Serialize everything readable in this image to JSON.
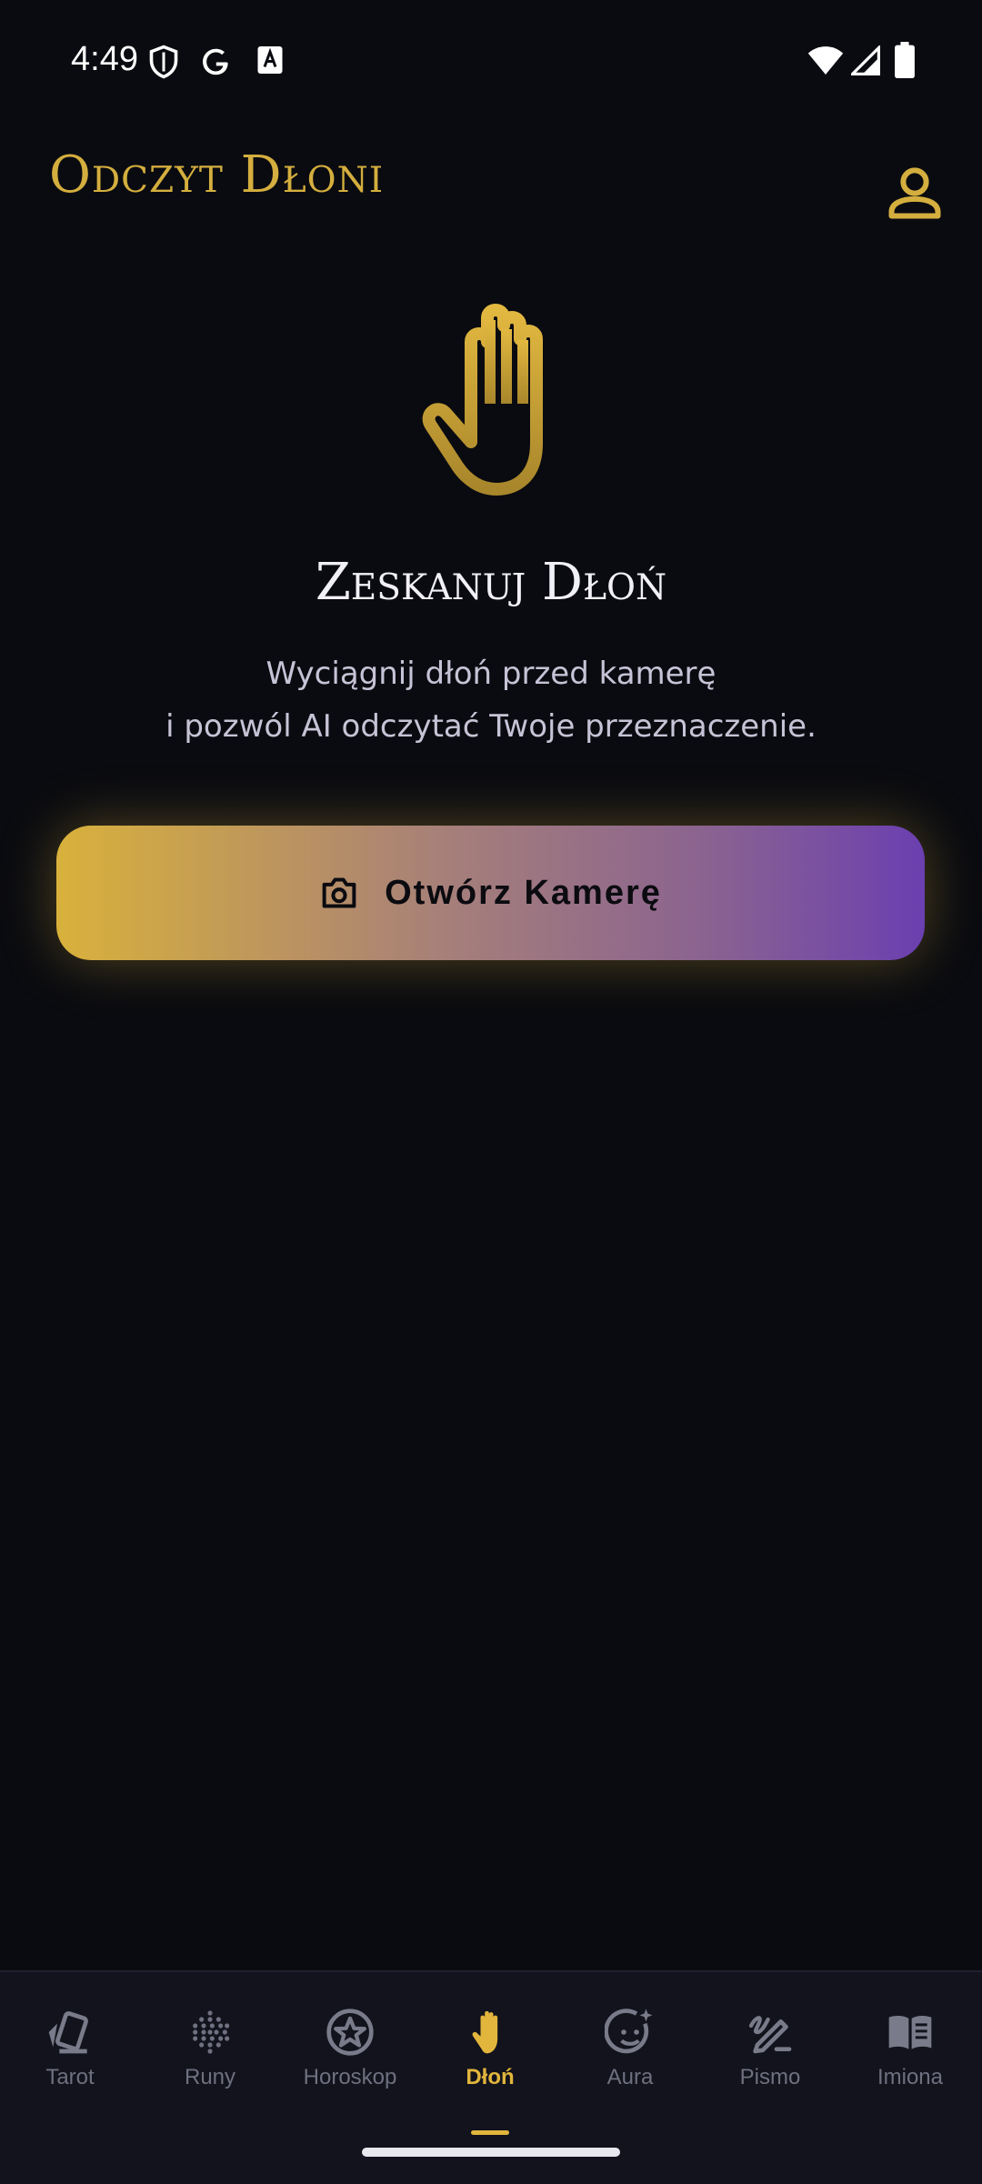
{
  "status_bar": {
    "time": "4:49"
  },
  "header": {
    "title": "Odczyt Dłoni"
  },
  "main": {
    "title": "Zeskanuj Dłoń",
    "description_line1": "Wyciągnij dłoń przed kamerę",
    "description_line2": "i pozwól AI odczytać Twoje przeznaczenie.",
    "camera_button_label": "Otwórz Kamerę"
  },
  "bottom_nav": {
    "items": [
      {
        "label": "Tarot",
        "icon": "tarot-cards-icon",
        "active": false
      },
      {
        "label": "Runy",
        "icon": "runes-dots-icon",
        "active": false
      },
      {
        "label": "Horoskop",
        "icon": "star-circle-icon",
        "active": false
      },
      {
        "label": "Dłoń",
        "icon": "hand-icon",
        "active": true
      },
      {
        "label": "Aura",
        "icon": "aura-face-icon",
        "active": false
      },
      {
        "label": "Pismo",
        "icon": "handwriting-pen-icon",
        "active": false
      },
      {
        "label": "Imiona",
        "icon": "open-book-icon",
        "active": false
      }
    ]
  },
  "colors": {
    "accent": "#d4ae3e",
    "background": "#0a0b10",
    "gradient_start": "#d9b13b",
    "gradient_end": "#6b3fb0"
  }
}
